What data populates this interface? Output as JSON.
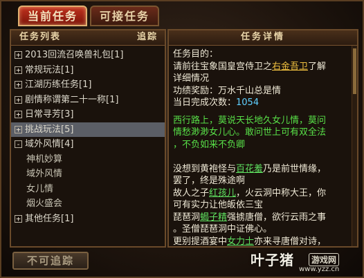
{
  "tabs": [
    {
      "label": "当前任务",
      "active": true
    },
    {
      "label": "可接任务",
      "active": false
    }
  ],
  "left_panel": {
    "title": "任务列表",
    "track_label": "追踪",
    "items": [
      {
        "toggle": "+",
        "label": "2013回流召唤兽礼包[1]"
      },
      {
        "toggle": "+",
        "label": "常规玩法[1]"
      },
      {
        "toggle": "+",
        "label": "江湖历练任务[1]"
      },
      {
        "toggle": "+",
        "label": "剧情称谓第二十一称[1]"
      },
      {
        "toggle": "+",
        "label": "日常寻芳[3]"
      },
      {
        "toggle": "+",
        "label": "挑战玩法[5]",
        "selected": true
      },
      {
        "toggle": "-",
        "label": "域外风情[4]"
      },
      {
        "toggle": "",
        "label": "神机妙算",
        "child": true
      },
      {
        "toggle": "",
        "label": "域外风情",
        "child": true
      },
      {
        "toggle": "",
        "label": "女儿情",
        "child": true
      },
      {
        "toggle": "",
        "label": "烟火盛会",
        "child": true
      },
      {
        "toggle": "+",
        "label": "其他任务[1]"
      }
    ]
  },
  "right_panel": {
    "title": "任务详情",
    "goal_label": "任务目的：",
    "goal_prefix": "请前往宝象国皇宫侍卫之",
    "goal_npc": "右金吾卫",
    "goal_suffix1": "了解",
    "goal_suffix2": "详细情况",
    "reward": "功绩奖励：万水千山总是情",
    "count_label": "当日完成次数：",
    "count_value": "1054",
    "poem_line1": "西行路上，莫说天长地久女儿情，莫问",
    "poem_line2": "情愁渺渺女儿心。敢问世上可有双全法",
    "poem_line3": "，不负如来不负卿",
    "story_line1_pre": "没想到黄袍怪与",
    "story_line1_npc": "百花羞",
    "story_line1_post": "乃是前世情缘，",
    "story_line2": "罢了，终是殊途啊",
    "story_line3_pre": "故人之子",
    "story_line3_npc": "红孩儿",
    "story_line3_post": "，火云洞中称大王，你",
    "story_line4": "可有实力让他皈依三宝",
    "story_line5_pre": "琵琶洞",
    "story_line5_npc": "蝎子精",
    "story_line5_post": "强掳唐僧，欲行云雨之事",
    "story_line6": "。圣僧琵琶洞中证佛心。",
    "story_line7_pre": "更别提酒宴中",
    "story_line7_npc": "女力士",
    "story_line7_post": "亦来寻唐僧对诗，"
  },
  "bottom": {
    "untrack_label": "不可追踪"
  },
  "watermark": {
    "big": "叶子猪",
    "logo": "游戏网",
    "url": "www.yzz.cn"
  }
}
